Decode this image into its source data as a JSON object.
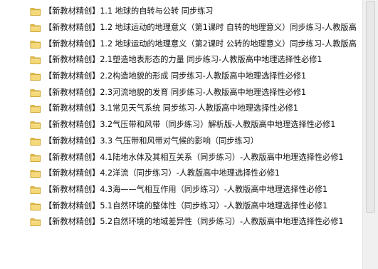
{
  "files": [
    {
      "name": "【新教材精创】1.1 地球的自转与公转 同步练习",
      "icon": "folder-icon"
    },
    {
      "name": "【新教材精创】1.2 地球运动的地理意义（第1课时 自转的地理意义）同步练习-人教版高",
      "icon": "folder-icon"
    },
    {
      "name": "【新教材精创】1.2 地球运动的地理意义（第2课时 公转的地理意义）同步练习-人教版高",
      "icon": "folder-icon"
    },
    {
      "name": "【新教材精创】2.1塑造地表形态的力量 同步练习-人教版高中地理选择性必修1",
      "icon": "folder-icon"
    },
    {
      "name": "【新教材精创】2.2构造地貌的形成 同步练习-人教版高中地理选择性必修1",
      "icon": "folder-icon"
    },
    {
      "name": "【新教材精创】2.3河流地貌的发育 同步练习-人教版高中地理选择性必修1",
      "icon": "folder-icon"
    },
    {
      "name": "【新教材精创】3.1常见天气系统 同步练习-人教版高中地理选择性必修1",
      "icon": "folder-icon"
    },
    {
      "name": "【新教材精创】3.2气压带和风带（同步练习）解析版-人教版高中地理选择性必修1",
      "icon": "folder-icon"
    },
    {
      "name": "【新教材精创】3.3 气压带和风带对气候的影响（同步练习）",
      "icon": "folder-icon"
    },
    {
      "name": "【新教材精创】4.1陆地水体及其相互关系（同步练习）-人教版高中地理选择性必修1",
      "icon": "folder-icon"
    },
    {
      "name": "【新教材精创】4.2洋流（同步练习）-人教版高中地理选择性必修1",
      "icon": "folder-icon"
    },
    {
      "name": "【新教材精创】4.3海——气相互作用（同步练习）-人教版高中地理选择性必修1",
      "icon": "folder-icon"
    },
    {
      "name": "【新教材精创】5.1自然环境的整体性（同步练习）-人教版高中地理选择性必修1",
      "icon": "folder-icon"
    },
    {
      "name": "【新教材精创】5.2自然环境的地域差异性（同步练习）-人教版高中地理选择性必修1",
      "icon": "folder-icon"
    }
  ],
  "colors": {
    "folder_body": "#e8c04a",
    "folder_front": "#f5d878",
    "folder_edge": "#c9a02c",
    "text": "#111111",
    "background": "#ffffff"
  }
}
